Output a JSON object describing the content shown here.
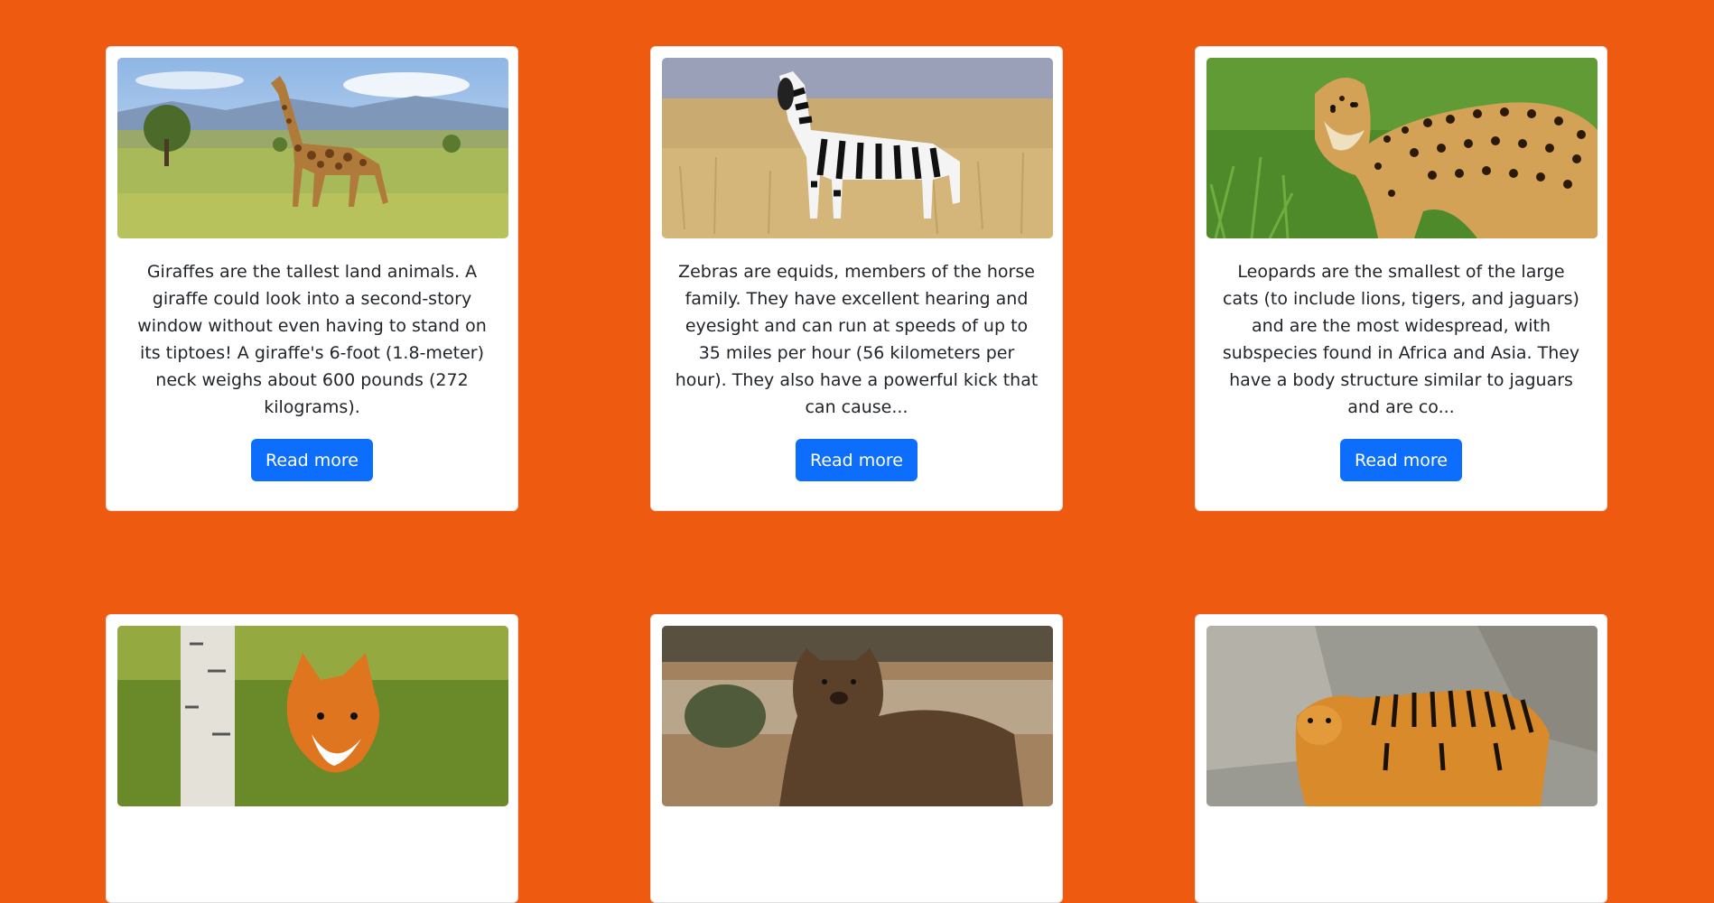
{
  "colors": {
    "page_background": "#ee5a10",
    "card_background": "#ffffff",
    "button_background": "#0d6efd",
    "button_text": "#ffffff",
    "body_text": "#212529"
  },
  "cards": [
    {
      "image": "giraffe-photo",
      "text": "Giraffes are the tallest land animals. A giraffe could look into a second-story window without even having to stand on its tiptoes! A giraffe's 6-foot (1.8-meter) neck weighs about 600 pounds (272 kilograms).",
      "button_label": "Read more"
    },
    {
      "image": "zebra-photo",
      "text": "Zebras are equids, members of the horse family. They have excellent hearing and eyesight and can run at speeds of up to 35 miles per hour (56 kilometers per hour). They also have a powerful kick that can cause...",
      "button_label": "Read more"
    },
    {
      "image": "leopard-photo",
      "text": "Leopards are the smallest of the large cats (to include lions, tigers, and jaguars) and are the most widespread, with subspecies found in Africa and Asia. They have a body structure similar to jaguars and are co...",
      "button_label": "Read more"
    },
    {
      "image": "fox-photo"
    },
    {
      "image": "bear-photo"
    },
    {
      "image": "tiger-photo"
    }
  ]
}
